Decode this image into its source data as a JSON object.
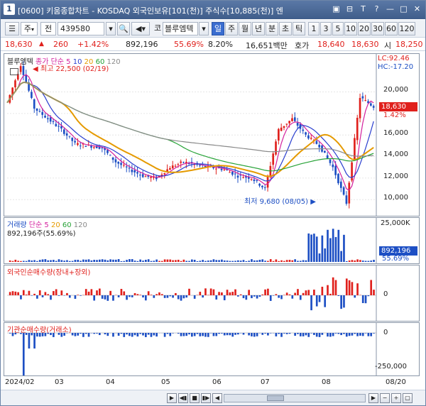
{
  "window": {
    "number": "1",
    "title": "[0600] 키움종합차트 - KOSDAQ 외국인보유[101(천)] 주식수[10,885(천)] 엔",
    "controls": [
      "▣",
      "⊟",
      "T",
      "?",
      "—",
      "□",
      "✕"
    ]
  },
  "toolbar": {
    "chart_type": "주",
    "chart_type_dropdown": "▾",
    "market": "전",
    "code": "439580",
    "search_icon": "search-icon",
    "corp_label": "코",
    "name": "블루엠텍",
    "periods": [
      "일",
      "주",
      "월",
      "년",
      "분",
      "초",
      "틱"
    ],
    "selected_period": "일",
    "intervals": [
      "1",
      "3",
      "5",
      "10",
      "20",
      "30",
      "60",
      "120"
    ]
  },
  "quote": {
    "price": "18,630",
    "arrow": "▲",
    "change": "260",
    "change_pct": "+1.42%",
    "volume": "892,196",
    "ratio": "55.69%",
    "turnover": "8.20%",
    "amount": "16,651백만",
    "hoga_label": "호가",
    "ask": "18,640",
    "bid": "18,630",
    "open_label": "시",
    "open": "18,250"
  },
  "price_panel": {
    "legend_name": "블루엠텍",
    "legend_ma": "종가 단순",
    "ma_periods": [
      "5",
      "10",
      "20",
      "60",
      "120"
    ],
    "high_label": "최고 22,500 (02/19)",
    "low_label": "최저 9,680 (08/05)",
    "lc_label": "LC:92.46",
    "hc_label": "HC:-17.20",
    "price_tag": "18,630",
    "pct_tag": "1.42%",
    "y_ticks": [
      "20,000",
      "18,000",
      "16,000",
      "14,000",
      "12,000",
      "10,000"
    ]
  },
  "volume_panel": {
    "legend_name": "거래량",
    "legend_ma": "단순",
    "ma_periods": [
      "5",
      "20",
      "60",
      "120"
    ],
    "volume_label": "892,196주(55.69%)",
    "y_max": "25,000K",
    "volume_tag": "892,196",
    "pct_tag": "55.69%"
  },
  "foreign_panel": {
    "legend": "외국인순매수량(장내+장외)",
    "y_tick": "0"
  },
  "inst_panel": {
    "legend": "기관순매수량(거래소)",
    "y_ticks": [
      "0",
      "-250,000"
    ]
  },
  "x_axis": {
    "labels": [
      "2024/02",
      "03",
      "04",
      "05",
      "06",
      "07",
      "08"
    ],
    "right_label": "08/20"
  },
  "colors": {
    "up": "#e0201c",
    "down": "#1d4fc4",
    "ma5": "#d4209e",
    "ma10": "#2a3fcf",
    "ma20": "#e59a00",
    "ma60": "#26a236",
    "ma120": "#8a8a8a"
  },
  "chart_data": {
    "type": "candlestick",
    "approx_close_by_month": {
      "2024/02": [
        19000,
        22500,
        18500,
        17500
      ],
      "03": [
        16500,
        15200,
        15000,
        14800
      ],
      "04": [
        13500,
        12800,
        12200,
        12000
      ],
      "05": [
        13000,
        13500,
        13200,
        13000
      ],
      "06": [
        12800,
        12200,
        12000,
        11000
      ],
      "07": [
        16500,
        17500,
        16000,
        15000
      ],
      "08": [
        13000,
        9680,
        19500,
        18630
      ]
    },
    "high": 22500,
    "low": 9680,
    "last": 18630
  }
}
